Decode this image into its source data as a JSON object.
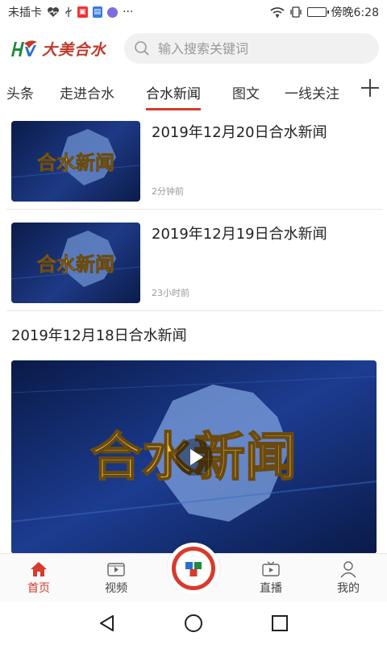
{
  "status_bar": {
    "carrier": "未插卡",
    "time": "傍晚6:28",
    "more": "···"
  },
  "header": {
    "logo_text": "大美合水",
    "search_placeholder": "输入搜索关键词"
  },
  "tabs": [
    {
      "label": "头条"
    },
    {
      "label": "走进合水"
    },
    {
      "label": "合水新闻",
      "active": true
    },
    {
      "label": "图文"
    },
    {
      "label": "一线关注"
    }
  ],
  "news": [
    {
      "title": "2019年12月20日合水新闻",
      "time": "2分钟前",
      "thumb_text": "合水新闻"
    },
    {
      "title": "2019年12月19日合水新闻",
      "time": "23小时前",
      "thumb_text": "合水新闻"
    },
    {
      "title": "2019年12月18日合水新闻",
      "thumb_text": "合水新闻"
    }
  ],
  "bottom_nav": [
    {
      "label": "首页",
      "icon": "home-icon",
      "active": true
    },
    {
      "label": "视频",
      "icon": "video-icon"
    },
    {
      "label": "直播",
      "icon": "tv-icon"
    },
    {
      "label": "我的",
      "icon": "user-icon"
    }
  ],
  "colors": {
    "accent": "#d83a2b",
    "thumb_bg": "#0c1f57"
  }
}
